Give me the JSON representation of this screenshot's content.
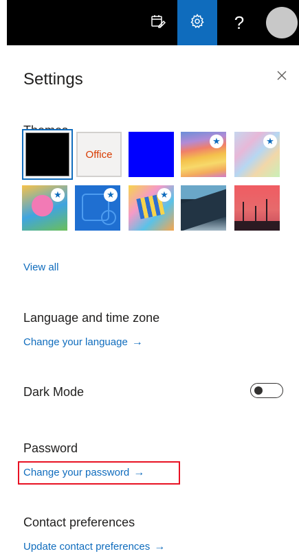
{
  "topbar": {
    "icons": [
      "calendar-edit-icon",
      "gear-icon",
      "help-icon",
      "avatar"
    ],
    "help_label": "?",
    "settings_active_color": "#0f6cbd"
  },
  "settings": {
    "title": "Settings",
    "close_icon": "close-icon",
    "themes": {
      "heading": "Themes",
      "office_label": "Office",
      "view_all": "View all",
      "selected": "black"
    },
    "language": {
      "heading": "Language and time zone",
      "link": "Change your language"
    },
    "dark_mode": {
      "heading": "Dark Mode",
      "enabled": false
    },
    "password": {
      "heading": "Password",
      "link": "Change your password"
    },
    "contact": {
      "heading": "Contact preferences",
      "link": "Update contact preferences"
    },
    "arrow": "→",
    "star": "★"
  }
}
